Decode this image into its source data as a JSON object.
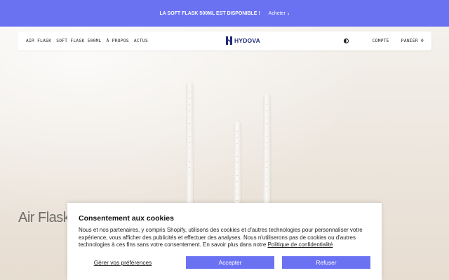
{
  "announcement": {
    "text": "LA SOFT FLASK 500ML EST DISPONIBLE !",
    "link": "Acheter",
    "link_icon": "chevron-right-icon"
  },
  "nav": {
    "links": [
      "AIR FLASK",
      "SOFT FLASK 500ML",
      "À PROPOS",
      "ACTUS"
    ],
    "logo": "HYDOVA",
    "theme_toggle_icon": "contrast-icon",
    "account": "COMPTE",
    "cart": "PANIER 0"
  },
  "hero": {
    "title": "Air Flask"
  },
  "cookie": {
    "title": "Consentement aux cookies",
    "body": "Nous et nos partenaires, y compris Shopify, utilisons des cookies et d'autres technologies pour personnaliser votre expérience, vous afficher des publicités et effectuer des analyses. Nous n'utiliserons pas de cookies ou d'autres technologies à ces fins sans votre consentement. En savoir plus dans notre ",
    "policy_link": "Politique de confidentialité",
    "preferences": "Gérer vos préférences",
    "accept": "Accepter",
    "refuse": "Refuser"
  },
  "colors": {
    "accent": "#6b72f2",
    "logo": "#1e2a78",
    "background": "#efebe6"
  }
}
